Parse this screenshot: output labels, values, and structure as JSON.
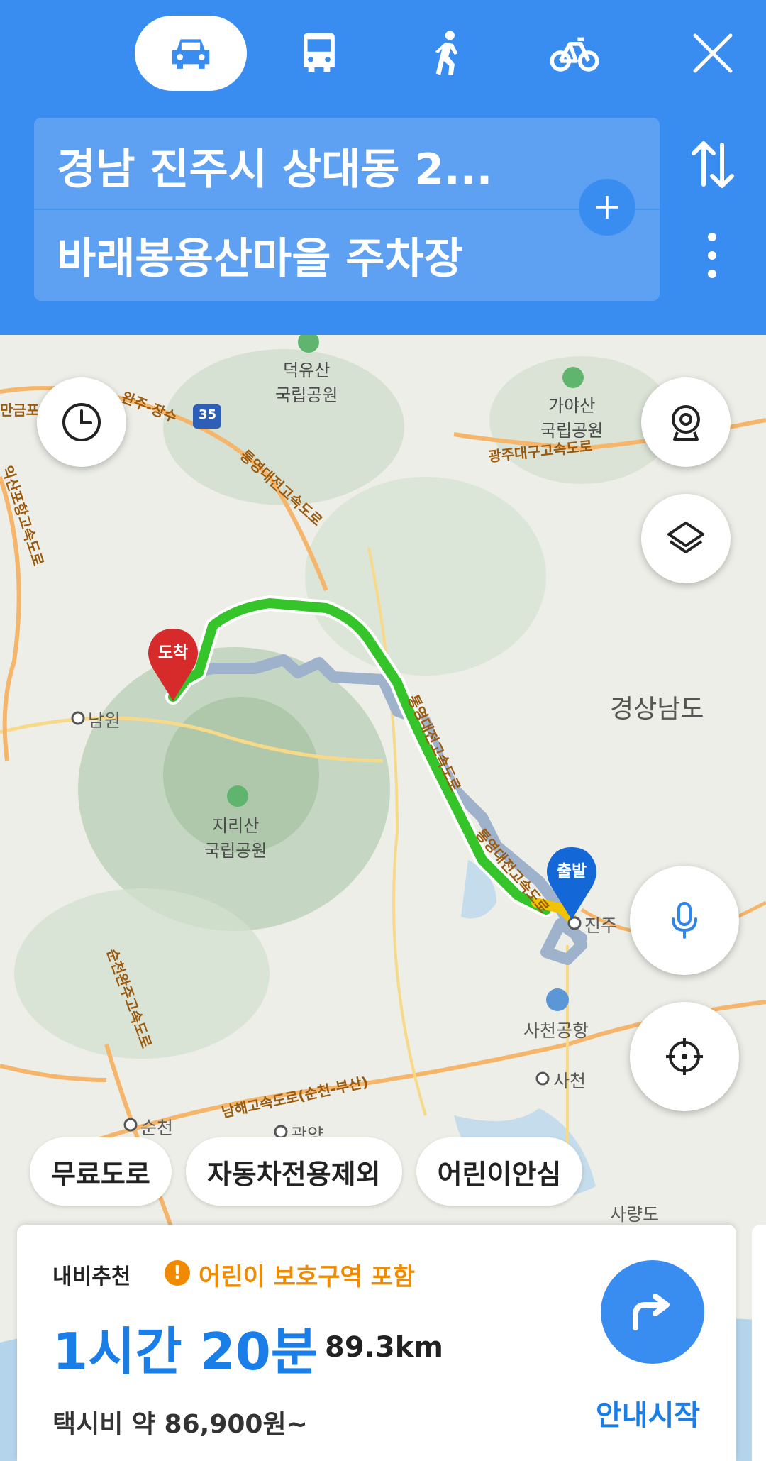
{
  "header": {
    "modes": [
      {
        "name": "car",
        "active": true
      },
      {
        "name": "bus",
        "active": false
      },
      {
        "name": "walk",
        "active": false
      },
      {
        "name": "bike",
        "active": false
      }
    ],
    "origin": "경남 진주시 상대동 2...",
    "destination": "바래봉용산마을 주차장"
  },
  "map": {
    "labels": {
      "deogyusan": "덕유산\n국립공원",
      "gayasan": "가야산\n국립공원",
      "jirisan": "지리산\n국립공원",
      "gyeongnam": "경상남도",
      "namwon": "남원",
      "jinju": "진주",
      "sacheon_airport": "사천공항",
      "sacheon": "사천",
      "suncheon": "순천",
      "gwangyang": "광양",
      "saryangdo": "사량도",
      "highway_35": "35"
    },
    "road_labels": {
      "tongyeong_daejeon": "통영대전고속도로",
      "gwangju_daegu": "광주대구고속도로",
      "namhae": "남해고속도로(순천-부산)",
      "suncheon_wanju": "순천완주고속도로",
      "iksan_pohang": "익산포항고속도로",
      "imsil": "완주-장수",
      "left_edge": "만금포"
    },
    "pins": {
      "arrival": "도착",
      "departure": "출발"
    }
  },
  "filters": [
    "무료도로",
    "자동차전용제외",
    "어린이안심"
  ],
  "route_card": {
    "label": "내비추천",
    "warning": "어린이 보호구역 포함",
    "duration": "1시간 20분",
    "distance": "89.3km",
    "taxi": "택시비 약 86,900원~",
    "start_label": "안내시작"
  },
  "colors": {
    "header_blue": "#3a8df0",
    "route_green": "#35c42a",
    "alt_route": "#9eb2cc",
    "warning_orange": "#f08a00"
  }
}
